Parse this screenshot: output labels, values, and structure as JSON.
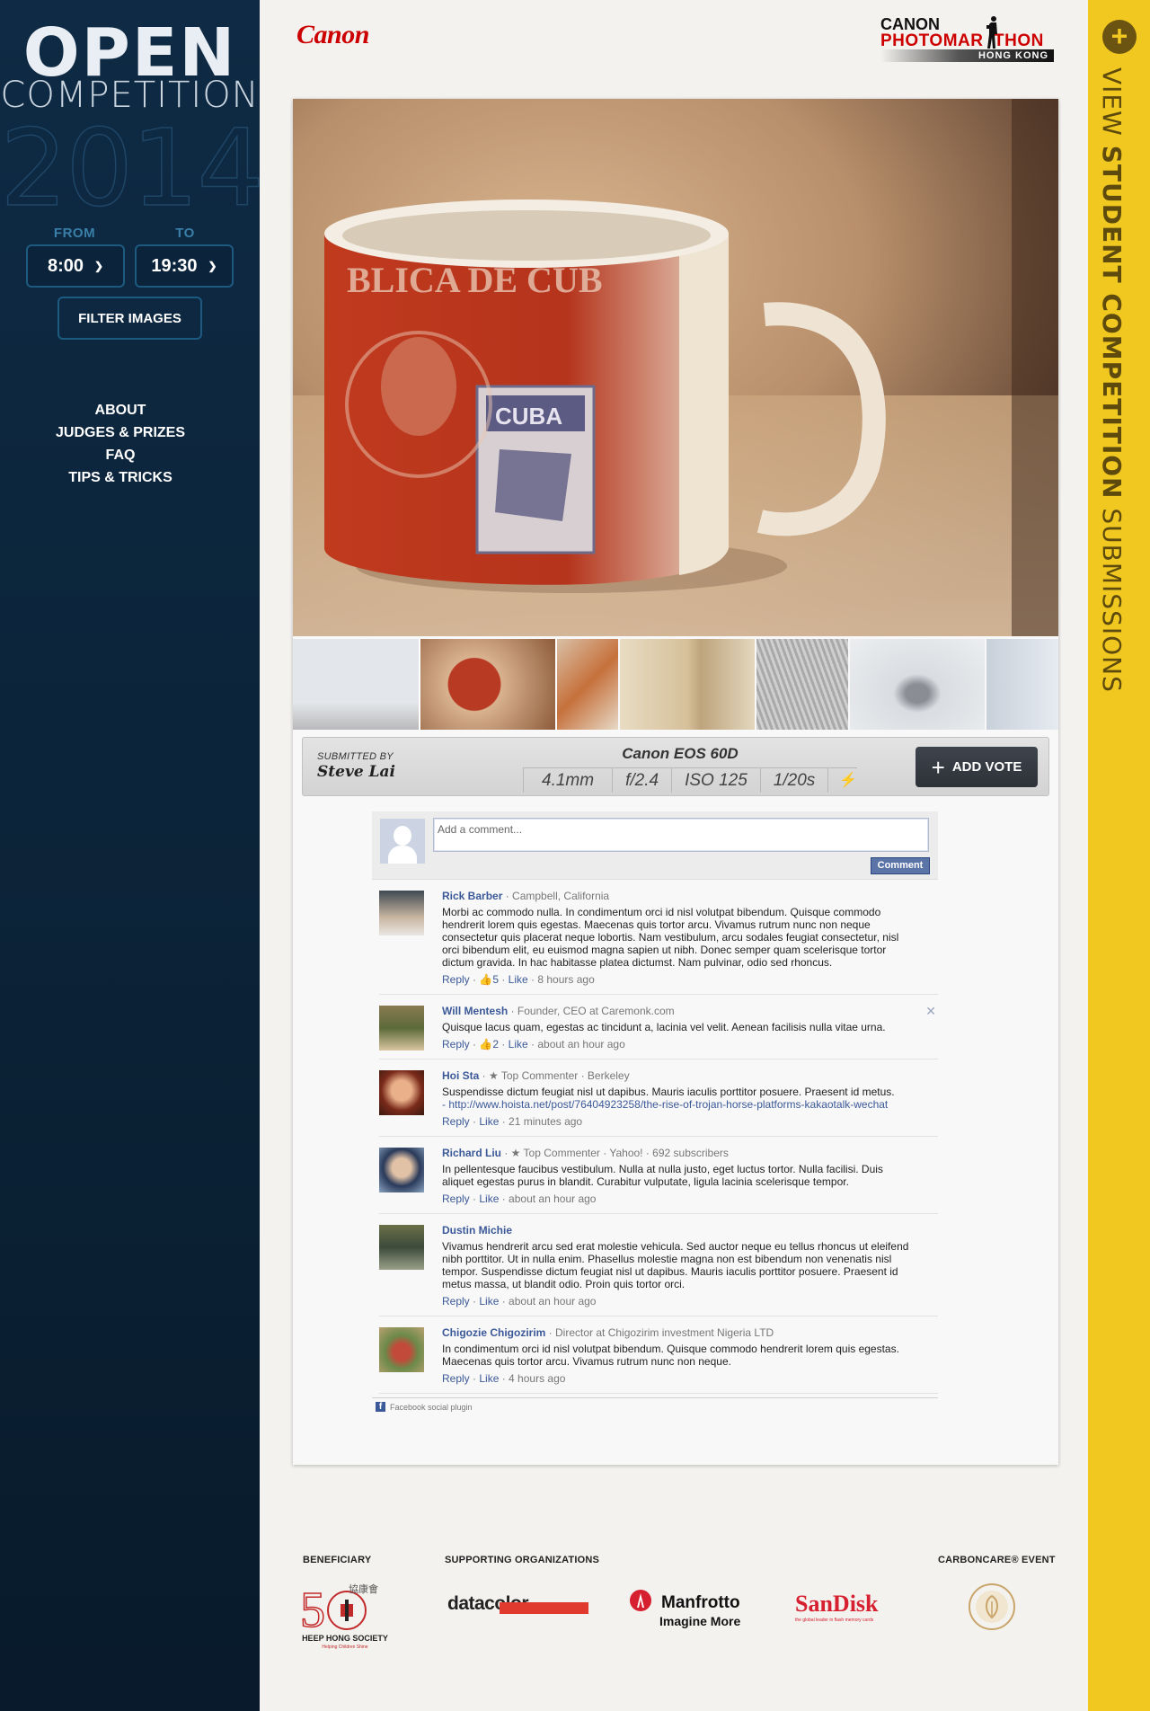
{
  "sidebar": {
    "title_line1": "OPEN",
    "title_line2": "COMPETITION",
    "year": "2014",
    "from_label": "FROM",
    "to_label": "TO",
    "from_value": "8:00",
    "to_value": "19:30",
    "filter_button": "FILTER IMAGES",
    "nav": [
      "ABOUT",
      "JUDGES & PRIZES",
      "FAQ",
      "TIPS & TRICKS"
    ]
  },
  "rightbar": {
    "plus": "+",
    "text_light1": "VIEW ",
    "text_bold": "STUDENT COMPETITION",
    "text_light2": " SUBMISSIONS"
  },
  "header": {
    "canon": "Canon",
    "pm_line1": "CANON",
    "pm_line2": "PHOTOMAR  THON",
    "pm_line3": "HONG KONG"
  },
  "photo_info": {
    "submitted_by_label": "SUBMITTED BY",
    "submitter": "Steve Lai",
    "camera": "Canon EOS 60D",
    "specs": [
      "4.1mm",
      "f/2.4",
      "ISO 125",
      "1/20s"
    ],
    "vote_button": "ADD VOTE"
  },
  "comment_box": {
    "placeholder": "Add a comment...",
    "button": "Comment"
  },
  "comments": [
    {
      "name": "Rick Barber",
      "meta": " · Campbell, California",
      "text": "Morbi ac commodo nulla. In condimentum orci id nisl volutpat bibendum. Quisque commodo hendrerit lorem quis egestas. Maecenas quis tortor arcu. Vivamus rutrum nunc non neque consectetur quis placerat neque lobortis. Nam vestibulum, arcu sodales feugiat consectetur, nisl orci bibendum elit, eu euismod magna sapien ut nibh. Donec semper quam scelerisque tortor dictum gravida. In hac habitasse platea dictumst. Nam pulvinar, odio sed rhoncus.",
      "likes": "5",
      "time": "8 hours ago"
    },
    {
      "name": "Will Mentesh",
      "meta": " · Founder, CEO at Caremonk.com",
      "text": "Quisque lacus quam, egestas ac tincidunt a, lacinia vel velit. Aenean facilisis nulla vitae urna.",
      "likes": "2",
      "time": "about an hour ago"
    },
    {
      "name": "Hoi Sta",
      "meta": " · ★ Top Commenter · Berkeley",
      "text": "Suspendisse dictum feugiat nisl ut dapibus. Mauris iaculis porttitor posuere. Praesent id metus.",
      "link": "- http://www.hoista.net/post/76404923258/the-rise-of-trojan-horse-platforms-kakaotalk-wechat",
      "likes": "",
      "time": "21 minutes ago"
    },
    {
      "name": "Richard Liu",
      "meta": " · ★ Top Commenter · Yahoo! · 692 subscribers",
      "text": "In pellentesque faucibus vestibulum. Nulla at nulla justo, eget luctus tortor. Nulla facilisi. Duis aliquet egestas purus in blandit. Curabitur vulputate, ligula lacinia scelerisque tempor.",
      "likes": "",
      "time": "about an hour ago"
    },
    {
      "name": "Dustin Michie",
      "meta": "",
      "text": "Vivamus hendrerit arcu sed erat molestie vehicula. Sed auctor neque eu tellus rhoncus ut eleifend nibh porttitor. Ut in nulla enim. Phasellus molestie magna non est bibendum non venenatis nisl tempor. Suspendisse dictum feugiat nisl ut dapibus. Mauris iaculis porttitor posuere. Praesent id metus massa, ut blandit odio. Proin quis tortor orci.",
      "likes": "",
      "time": "about an hour ago"
    },
    {
      "name": "Chigozie Chigozirim",
      "meta": " · Director at Chigozirim investment Nigeria LTD",
      "text": "In condimentum orci id nisl volutpat bibendum. Quisque commodo hendrerit lorem quis egestas. Maecenas quis tortor arcu. Vivamus rutrum nunc non neque.",
      "likes": "",
      "time": "4 hours ago"
    }
  ],
  "comment_actions": {
    "reply": "Reply",
    "like": "Like",
    "sep": " · "
  },
  "fb_plugin": "Facebook social plugin",
  "footer": {
    "beneficiary": "BENEFICIARY",
    "supporting": "SUPPORTING ORGANIZATIONS",
    "carbon": "CARBONCARE® EVENT",
    "heephong": "HEEP HONG SOCIETY",
    "heephong_cn": "協康會",
    "heephong_sub": "Helping Children Shine",
    "datacolor": "datacolor",
    "manfrotto": "Manfrotto",
    "manfrotto_sub": "Imagine More",
    "sandisk": "SanDisk",
    "sandisk_sub": "the global leader in flash memory cards"
  },
  "colors": {
    "sidebar_bg": "#0e2a44",
    "rightbar_bg": "#f0c81f",
    "canon_red": "#cc0000",
    "fb_blue": "#3b5998"
  },
  "icons": {
    "plus": "plus-circle-icon",
    "chevron": "chevron-down-icon",
    "flash": "flash-icon",
    "thumbs_up": "thumbs-up-icon",
    "close": "close-icon",
    "facebook": "facebook-icon"
  }
}
